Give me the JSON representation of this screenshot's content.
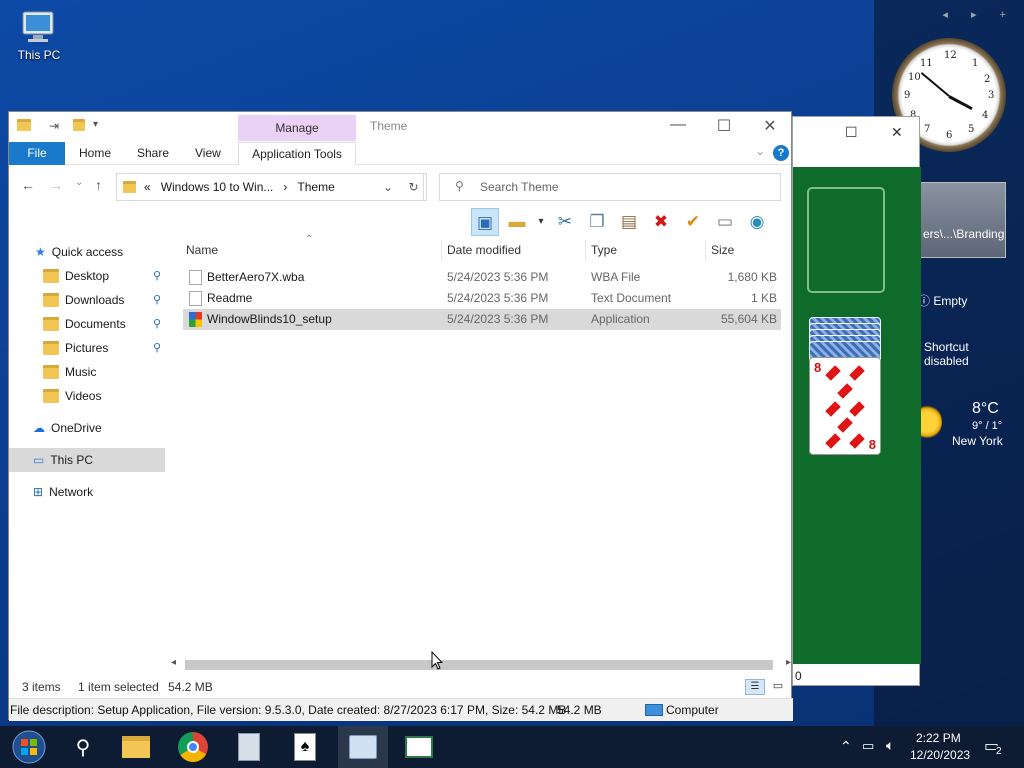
{
  "desktop": {
    "icon_label": "This PC"
  },
  "gadgets": {
    "nav_arrows": "◂ ▸ +",
    "clock_numbers": [
      "12",
      "1",
      "2",
      "3",
      "4",
      "5",
      "6",
      "7",
      "8",
      "9",
      "10",
      "11"
    ],
    "slideshow_label": "ers\\...\\Branding",
    "recycle_label": "Empty",
    "shortcut_line1": "Shortcut",
    "shortcut_line2": "disabled",
    "weather_temp": "8°C",
    "weather_range": "9° / 1°",
    "weather_city": "New York"
  },
  "solitaire": {
    "status": "0",
    "card_rank": "8"
  },
  "explorer": {
    "title": "Theme",
    "manage_tab": "Manage",
    "ribbon_tabs": {
      "file": "File",
      "home": "Home",
      "share": "Share",
      "view": "View",
      "app_tools": "Application Tools"
    },
    "address": {
      "prefix": "«",
      "seg1": "Windows 10 to Win...",
      "sep": "›",
      "seg2": "Theme"
    },
    "search_placeholder": "Search Theme",
    "nav": {
      "quick_access": "Quick access",
      "desktop": "Desktop",
      "downloads": "Downloads",
      "documents": "Documents",
      "pictures": "Pictures",
      "music": "Music",
      "videos": "Videos",
      "onedrive": "OneDrive",
      "this_pc": "This PC",
      "network": "Network"
    },
    "columns": {
      "name": "Name",
      "date": "Date modified",
      "type": "Type",
      "size": "Size"
    },
    "files": [
      {
        "name": "BetterAero7X.wba",
        "date": "5/24/2023 5:36 PM",
        "type": "WBA File",
        "size": "1,680 KB"
      },
      {
        "name": "Readme",
        "date": "5/24/2023 5:36 PM",
        "type": "Text Document",
        "size": "1 KB"
      },
      {
        "name": "WindowBlinds10_setup",
        "date": "5/24/2023 5:36 PM",
        "type": "Application",
        "size": "55,604 KB"
      }
    ],
    "status": {
      "items": "3 items",
      "selected": "1 item selected",
      "size": "54.2 MB"
    },
    "details": {
      "description": "File description: Setup Application, File version: 9.5.3.0, Date created: 8/27/2023 6:17 PM, Size: 54.2 MB",
      "size": "54.2 MB",
      "location": "Computer"
    }
  },
  "taskbar": {
    "time": "2:22 PM",
    "date": "12/20/2023",
    "notification_count": "2"
  }
}
